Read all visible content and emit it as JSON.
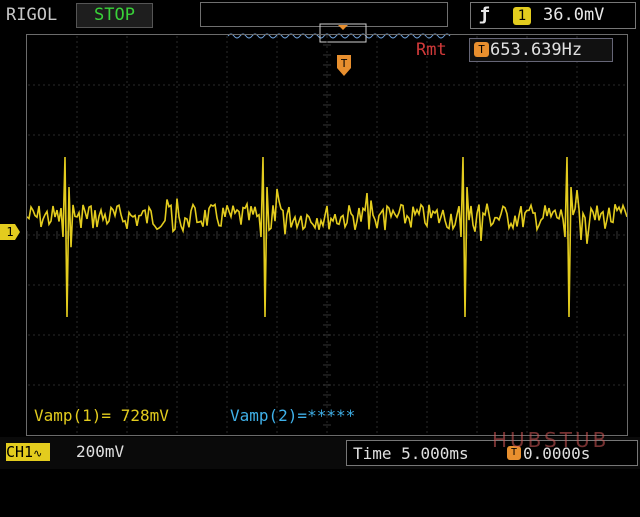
{
  "header": {
    "brand": "RIGOL",
    "run_state": "STOP",
    "trigger": {
      "edge_icon": "rising-edge-icon",
      "source": "1",
      "level": "36.0mV"
    }
  },
  "plot": {
    "mode_label": "Rmt",
    "frequency_badge": "T",
    "frequency": "653.639Hz",
    "trigger_marker": "T",
    "channel_marker": "1"
  },
  "measurements": {
    "m1": "Vamp(1)= 728mV",
    "m2": "Vamp(2)=*****"
  },
  "footer": {
    "channel_label": "CH1",
    "coupling_icon": "ac-coupling-icon",
    "vertical_scale": "200mV",
    "time_label": "Time",
    "time_scale": "5.000ms",
    "trigger_offset_badge": "T",
    "trigger_offset": "0.0000s"
  },
  "watermark": "HUBSTUB",
  "colors": {
    "channel1": "#e3cc1e",
    "channel2": "#3fb0e8",
    "run_state": "#39d239",
    "mode": "#d23a3a",
    "trigger_accent": "#e88f2e"
  }
}
